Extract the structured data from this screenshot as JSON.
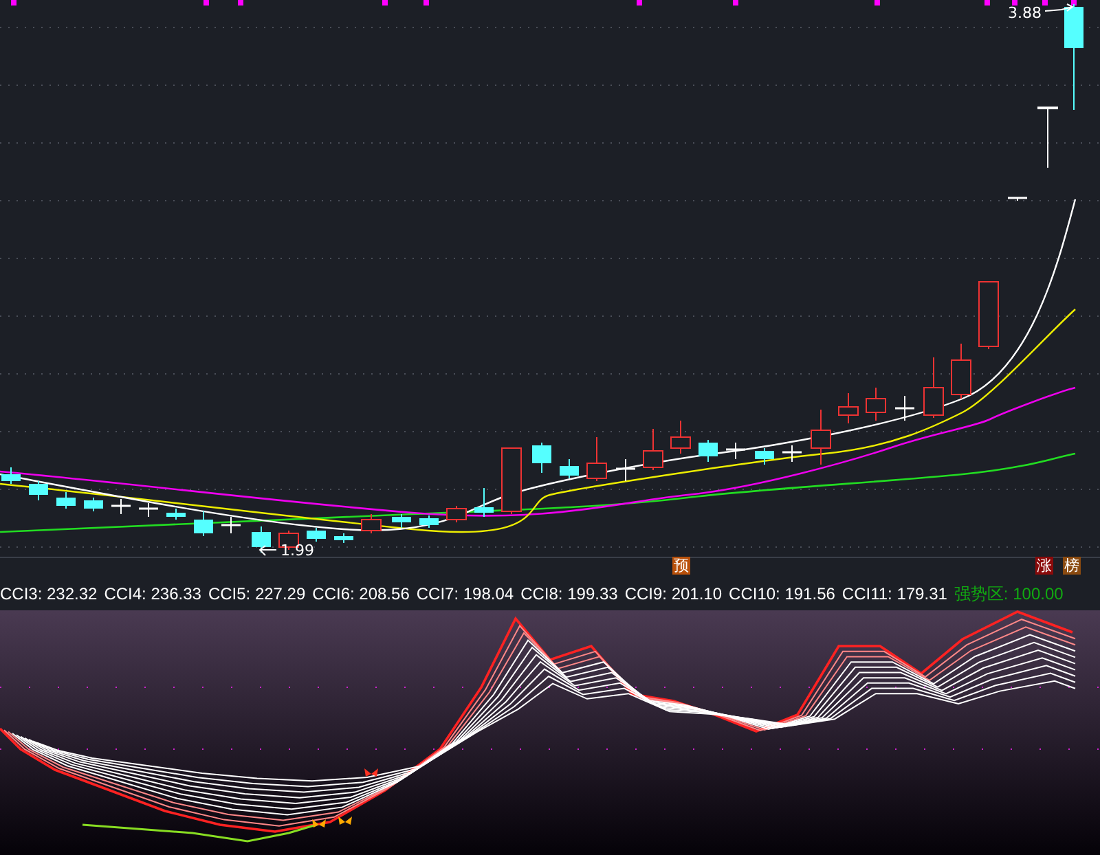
{
  "price_panel": {
    "high_label": "3.88",
    "low_label": "1.99"
  },
  "signal_markers": [
    {
      "text": "预",
      "color": "#b8500a"
    },
    {
      "text": "涨",
      "color": "#8a0a0a"
    },
    {
      "text": "榜",
      "color": "#8a4a10"
    }
  ],
  "indicator_header": {
    "values": [
      {
        "label": "CCI3:",
        "value": "232.32"
      },
      {
        "label": "CCI4:",
        "value": "236.33"
      },
      {
        "label": "CCI5:",
        "value": "227.29"
      },
      {
        "label": "CCI6:",
        "value": "208.56"
      },
      {
        "label": "CCI7:",
        "value": "198.04"
      },
      {
        "label": "CCI8:",
        "value": "199.33"
      },
      {
        "label": "CCI9:",
        "value": "201.10"
      },
      {
        "label": "CCI10:",
        "value": "191.56"
      },
      {
        "label": "CCI11:",
        "value": "179.31"
      }
    ],
    "strong_zone": {
      "label": "强势区:",
      "value": "100.00"
    }
  }
}
